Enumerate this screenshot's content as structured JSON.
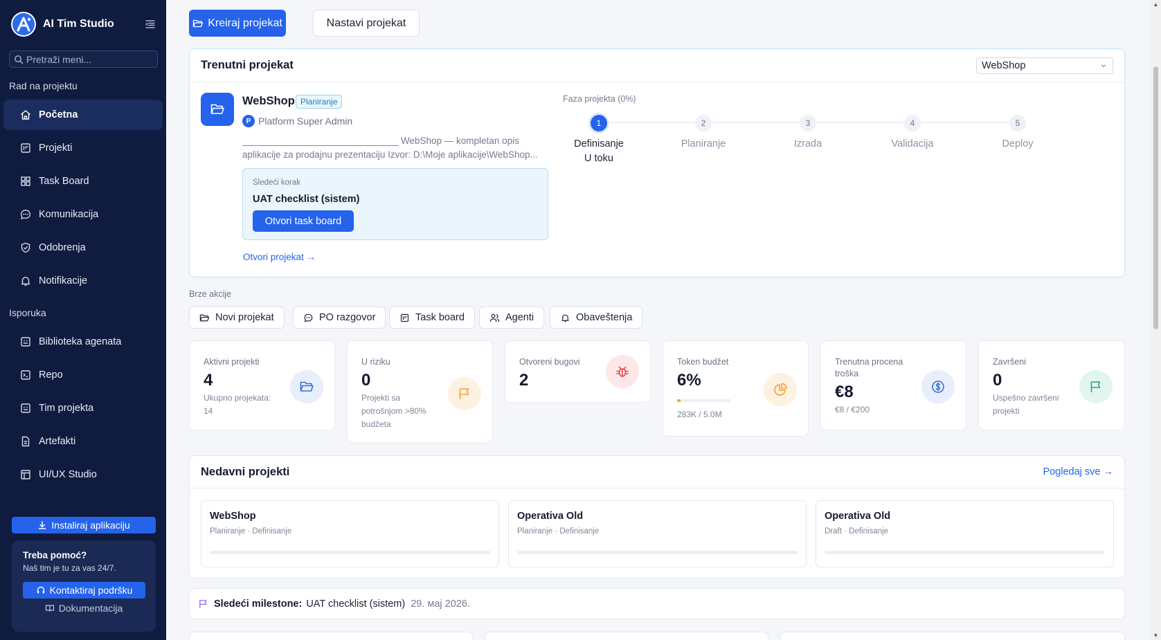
{
  "app": {
    "title": "AI Tim Studio"
  },
  "sidebar": {
    "search_placeholder": "Pretraži meni...",
    "section_work": "Rad na projektu",
    "section_delivery": "Isporuka",
    "work_items": [
      {
        "label": "Početna",
        "icon": "home-icon",
        "active": true
      },
      {
        "label": "Projekti",
        "icon": "projects-icon"
      },
      {
        "label": "Task Board",
        "icon": "grid-icon"
      },
      {
        "label": "Komunikacija",
        "icon": "chat-icon"
      },
      {
        "label": "Odobrenja",
        "icon": "shield-check-icon"
      },
      {
        "label": "Notifikacije",
        "icon": "bell-icon"
      }
    ],
    "delivery_items": [
      {
        "label": "Biblioteka agenata",
        "icon": "agent-library-icon"
      },
      {
        "label": "Repo",
        "icon": "terminal-icon"
      },
      {
        "label": "Tim projekta",
        "icon": "team-icon"
      },
      {
        "label": "Artefakti",
        "icon": "document-icon"
      },
      {
        "label": "UI/UX Studio",
        "icon": "layout-icon"
      }
    ],
    "install_label": "Instaliraj aplikaciju",
    "help": {
      "title": "Treba pomoć?",
      "subtitle": "Naš tim je tu za vas 24/7.",
      "contact_label": "Kontaktiraj podršku",
      "docs_label": "Dokumentacija"
    }
  },
  "toolbar": {
    "create_label": "Kreiraj projekat",
    "continue_label": "Nastavi projekat"
  },
  "current": {
    "title": "Trenutni projekat",
    "selected": "WebShop",
    "project_name": "WebShop",
    "status_badge": "Planiranje",
    "owner_initial": "P",
    "owner": "Platform Super Admin",
    "description": "______________________________ WebShop — kompletan opis aplikacije za prodajnu prezentaciju Izvor: D:\\Moje aplikacije\\WebShop...",
    "next_label": "Sledeći korak",
    "next_title": "UAT checklist (sistem)",
    "next_button": "Otvori task board",
    "open_link": "Otvori projekat →",
    "phase_label": "Faza projekta (0%)",
    "phase_progress": 0,
    "steps": [
      {
        "num": "1",
        "label": "Definisanje",
        "sub": "U toku",
        "active": true
      },
      {
        "num": "2",
        "label": "Planiranje",
        "sub": ""
      },
      {
        "num": "3",
        "label": "Izrada",
        "sub": ""
      },
      {
        "num": "4",
        "label": "Validacija",
        "sub": ""
      },
      {
        "num": "5",
        "label": "Deploy",
        "sub": ""
      }
    ]
  },
  "quick_actions": {
    "label": "Brze akcije",
    "items": [
      {
        "label": "Novi projekat",
        "icon": "folder-icon"
      },
      {
        "label": "PO razgovor",
        "icon": "chat-icon"
      },
      {
        "label": "Task board",
        "icon": "board-icon"
      },
      {
        "label": "Agenti",
        "icon": "agents-icon"
      },
      {
        "label": "Obaveštenja",
        "icon": "bell-icon"
      }
    ]
  },
  "stats": [
    {
      "title": "Aktivni projekti",
      "value": "4",
      "sub": "Ukupno projekata: 14",
      "icon": "folder-icon",
      "color": "#3b6fd8",
      "bg": "#e8eefb"
    },
    {
      "title": "U riziku",
      "value": "0",
      "sub": "Projekti sa potrošnjom >80% budžeta",
      "icon": "flag-icon",
      "color": "#f0a130",
      "bg": "#fdf1e2"
    },
    {
      "title": "Otvoreni bugovi",
      "value": "2",
      "sub": "",
      "icon": "bug-icon",
      "color": "#e0474c",
      "bg": "#fde7e8"
    },
    {
      "title": "Token budžet",
      "value": "6%",
      "sub": "283K / 5.0M",
      "icon": "pie-chart-icon",
      "color": "#f0a130",
      "bg": "#fdf1e2",
      "progress": 0.06
    },
    {
      "title": "Trenutna procena troška",
      "value": "€8",
      "sub": "€8 / €200",
      "icon": "dollar-icon",
      "color": "#3b6fd8",
      "bg": "#e8eefb"
    },
    {
      "title": "Završeni",
      "value": "0",
      "sub": "Uspešno završeni projekti",
      "icon": "flag-icon",
      "color": "#22a87a",
      "bg": "#e3f6ee"
    }
  ],
  "recent": {
    "title": "Nedavni projekti",
    "see_all": "Pogledaj sve →",
    "items": [
      {
        "name": "WebShop",
        "meta": "Planiranje · Definisanje"
      },
      {
        "name": "Operativa Old",
        "meta": "Planiranje · Definisanje"
      },
      {
        "name": "Operativa Old",
        "meta": "Draft · Definisanje"
      }
    ]
  },
  "milestone": {
    "label": "Sledeći milestone:",
    "value": "UAT checklist (sistem)",
    "date": "29. мај 2026."
  }
}
